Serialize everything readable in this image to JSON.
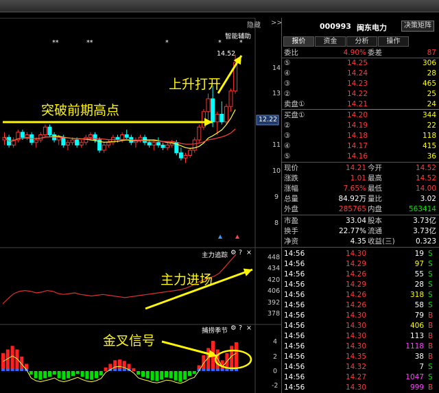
{
  "header": {
    "hide_label": "隐藏",
    "hide_arrow": ">>",
    "stock_code": "000993",
    "stock_name": "闽东电力",
    "decision_btn": "决策矩阵",
    "tabs": [
      "报价",
      "资金",
      "分析",
      "操作"
    ]
  },
  "chart": {
    "smart_assist": "智能辅助",
    "stars": [
      "**",
      "**",
      "*",
      "*",
      "*"
    ],
    "high_label": "14.52",
    "current_price_tag": "12.22",
    "price_ticks": [
      "14",
      "13",
      "12",
      "11",
      "10",
      "9",
      "8"
    ],
    "annotations": {
      "breakout": "突破前期高点",
      "open_up": "上升打开",
      "capital_in": "主力进场",
      "golden_cross": "金叉信号"
    },
    "panel2": {
      "title": "主力追踪",
      "icons": [
        "⚙",
        "?",
        "×"
      ],
      "ticks": [
        "448",
        "434",
        "420",
        "406",
        "392",
        "378"
      ]
    },
    "panel3": {
      "title": "捕捞季节",
      "icons": [
        "⚙",
        "?",
        "×"
      ],
      "ticks": [
        "4",
        "2",
        "0",
        "-2"
      ]
    }
  },
  "quote": {
    "weibi_label": "委比",
    "weibi_value": "4.90%",
    "weicha_label": "委差",
    "weicha_value": "87",
    "sell": [
      {
        "lbl": "⑤",
        "price": "14.25",
        "vol": "306"
      },
      {
        "lbl": "④",
        "price": "14.24",
        "vol": "28"
      },
      {
        "lbl": "③",
        "price": "14.23",
        "vol": "465"
      },
      {
        "lbl": "②",
        "price": "14.22",
        "vol": "25"
      },
      {
        "lbl": "卖盘①",
        "price": "14.21",
        "vol": "24"
      }
    ],
    "buy": [
      {
        "lbl": "买盘①",
        "price": "14.20",
        "vol": "344"
      },
      {
        "lbl": "②",
        "price": "14.19",
        "vol": "22"
      },
      {
        "lbl": "③",
        "price": "14.18",
        "vol": "118"
      },
      {
        "lbl": "④",
        "price": "14.17",
        "vol": "415"
      },
      {
        "lbl": "⑤",
        "price": "14.16",
        "vol": "36"
      }
    ],
    "stats": [
      {
        "l1": "现价",
        "v1": "14.21",
        "c1": "red",
        "l2": "今开",
        "v2": "14.52",
        "c2": "red"
      },
      {
        "l1": "涨跌",
        "v1": "1.01",
        "c1": "red",
        "l2": "最高",
        "v2": "14.52",
        "c2": "red"
      },
      {
        "l1": "涨幅",
        "v1": "7.65%",
        "c1": "red",
        "l2": "最低",
        "v2": "14.00",
        "c2": "red"
      },
      {
        "l1": "总量",
        "v1": "84.92万",
        "c1": "white",
        "l2": "量比",
        "v2": "3.02",
        "c2": "white"
      },
      {
        "l1": "外盘",
        "v1": "285765",
        "c1": "red",
        "l2": "内盘",
        "v2": "563414",
        "c2": "green"
      }
    ],
    "fundamentals": [
      {
        "l1": "市盈",
        "v1": "33.04",
        "l2": "股本",
        "v2": "3.73亿"
      },
      {
        "l1": "换手",
        "v1": "22.77%",
        "l2": "流通",
        "v2": "3.73亿"
      },
      {
        "l1": "净资",
        "v1": "4.35",
        "l2": "收益(三)",
        "v2": "0.323"
      }
    ],
    "ticks": [
      {
        "t": "14:56",
        "p": "14.30",
        "v": "19",
        "d": "S",
        "vc": "white"
      },
      {
        "t": "14:56",
        "p": "14.29",
        "v": "97",
        "d": "S",
        "vc": "yellow"
      },
      {
        "t": "14:56",
        "p": "14.26",
        "v": "55",
        "d": "S",
        "vc": "white"
      },
      {
        "t": "14:56",
        "p": "14.29",
        "v": "28",
        "d": "S",
        "vc": "white"
      },
      {
        "t": "14:56",
        "p": "14.26",
        "v": "318",
        "d": "S",
        "vc": "yellow"
      },
      {
        "t": "14:56",
        "p": "14.26",
        "v": "58",
        "d": "S",
        "vc": "white"
      },
      {
        "t": "14:56",
        "p": "14.30",
        "v": "79",
        "d": "B",
        "vc": "white"
      },
      {
        "t": "14:56",
        "p": "14.30",
        "v": "406",
        "d": "B",
        "vc": "yellow"
      },
      {
        "t": "14:56",
        "p": "14.30",
        "v": "113",
        "d": "B",
        "vc": "white"
      },
      {
        "t": "14:56",
        "p": "14.30",
        "v": "1118",
        "d": "B",
        "vc": "magenta"
      },
      {
        "t": "14:56",
        "p": "14.35",
        "v": "38",
        "d": "B",
        "vc": "white"
      },
      {
        "t": "14:56",
        "p": "14.32",
        "v": "7",
        "d": "S",
        "vc": "white"
      },
      {
        "t": "14:56",
        "p": "14.27",
        "v": "1047",
        "d": "S",
        "vc": "magenta"
      },
      {
        "t": "14:56",
        "p": "14.30",
        "v": "999",
        "d": "B",
        "vc": "magenta"
      }
    ]
  }
}
